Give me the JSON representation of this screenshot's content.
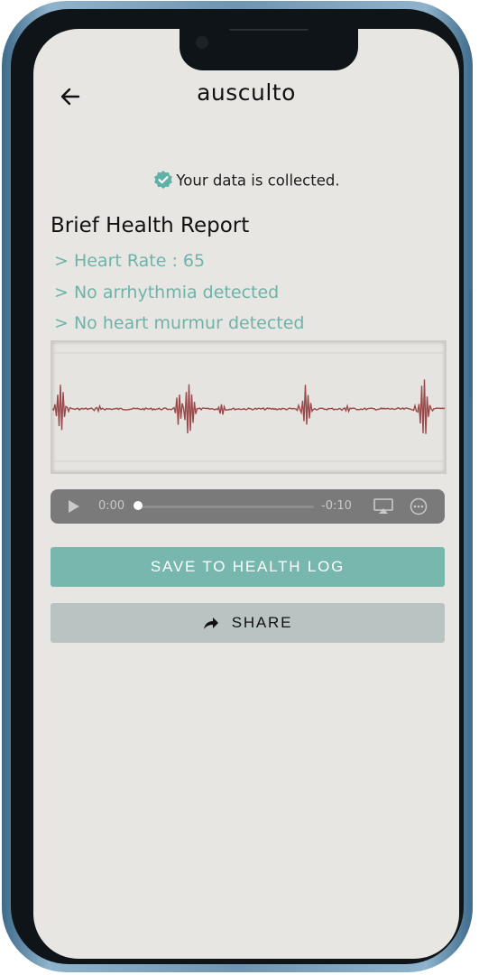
{
  "header": {
    "title": "ausculto",
    "back_icon": "arrow-left-icon"
  },
  "status": {
    "message": "Your data is collected.",
    "icon": "verified-badge-icon",
    "icon_color": "#5fb0a6"
  },
  "report": {
    "title": "Brief Health Report",
    "findings": [
      "> Heart Rate : 65",
      "> No arrhythmia detected",
      "> No heart murmur detected"
    ],
    "accent_color": "#6db3aa"
  },
  "waveform": {
    "icon": "heart-sound-waveform",
    "line_color": "#9a4a4a"
  },
  "player": {
    "current_time": "0:00",
    "remaining_time": "-0:10",
    "progress": 0,
    "play_icon": "play-icon",
    "airplay_icon": "airplay-icon",
    "more_icon": "more-options-icon"
  },
  "actions": {
    "save_label": "SAVE TO HEALTH LOG",
    "share_label": "SHARE",
    "share_icon": "share-arrow-icon",
    "save_color": "#78b7ad",
    "share_color": "#b9c4c2"
  }
}
